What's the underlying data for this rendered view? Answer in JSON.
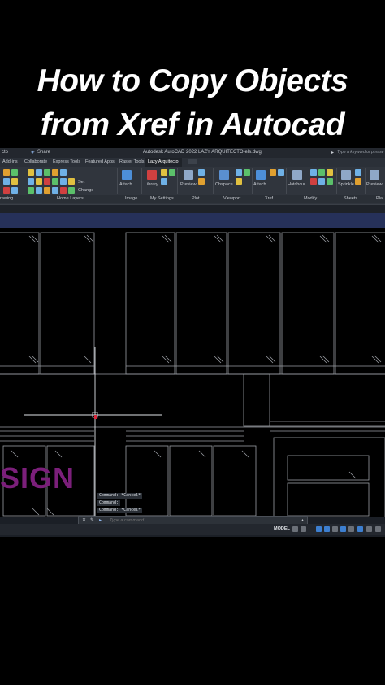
{
  "headline": {
    "line1": "How to Copy Objects",
    "line2": "from Xref in Autocad"
  },
  "app": {
    "title": "Autodesk AutoCAD 2022   LAZY ARQUITECTO-els.dwg",
    "quick_left": "cto",
    "share": "Share",
    "search_placeholder": "Type a keyword or phrase"
  },
  "ribbon_tabs": [
    "Add-ins",
    "Collaborate",
    "Express Tools",
    "Featured Apps",
    "Raster Tools",
    "Lazy Arquitecto"
  ],
  "ribbon_active_tab": "Lazy Arquitecto",
  "ribbon": {
    "set_label": "Set",
    "change_label": "Change",
    "attach1": "Attach",
    "library": "Library",
    "preview1": "Preview",
    "chspace": "Chspace",
    "attach2": "Attach",
    "hatchcur": "Hatchcur",
    "sprinkle": "Sprinkle",
    "preview2": "Preview"
  },
  "ribbon_panels": [
    "rawing",
    "Home Layers",
    "Image",
    "My Settings",
    "Plot",
    "Viewport",
    "Xref",
    "Modify",
    "Sheets",
    "Pla"
  ],
  "drawing": {
    "sign_text": "SIGN"
  },
  "command": {
    "history": [
      "Command: *Cancel*",
      "Command:",
      "Command: *Cancel*"
    ],
    "placeholder": "Type a command"
  },
  "status": {
    "model": "MODEL"
  },
  "colors": {
    "background": "#000000",
    "sign": "#7b1f7a",
    "ui_dark": "#1b1f26",
    "blue_bar": "#26315a",
    "crosshair_marker": "#d9263a"
  }
}
